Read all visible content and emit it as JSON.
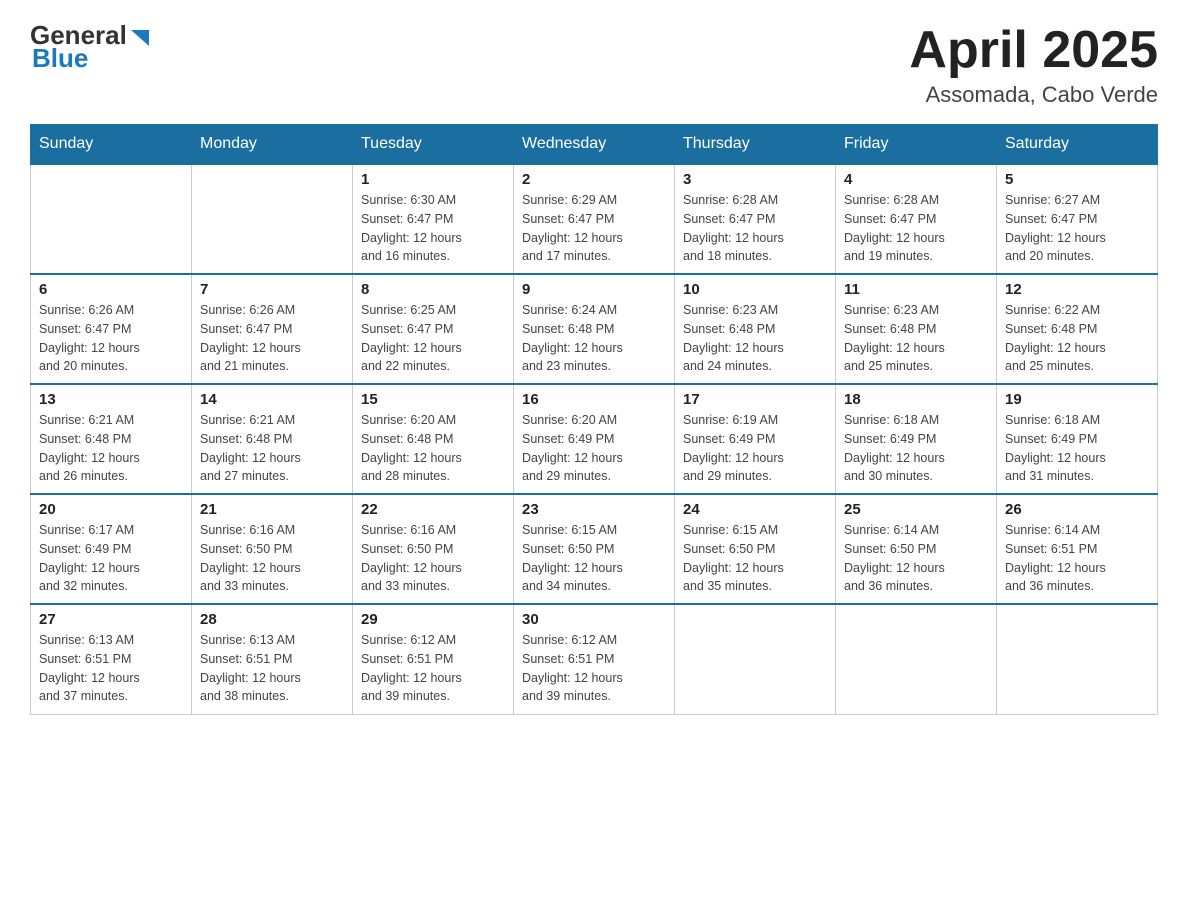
{
  "header": {
    "logo_general": "General",
    "logo_blue": "Blue",
    "title": "April 2025",
    "subtitle": "Assomada, Cabo Verde"
  },
  "days_of_week": [
    "Sunday",
    "Monday",
    "Tuesday",
    "Wednesday",
    "Thursday",
    "Friday",
    "Saturday"
  ],
  "weeks": [
    [
      {
        "day": "",
        "info": ""
      },
      {
        "day": "",
        "info": ""
      },
      {
        "day": "1",
        "info": "Sunrise: 6:30 AM\nSunset: 6:47 PM\nDaylight: 12 hours\nand 16 minutes."
      },
      {
        "day": "2",
        "info": "Sunrise: 6:29 AM\nSunset: 6:47 PM\nDaylight: 12 hours\nand 17 minutes."
      },
      {
        "day": "3",
        "info": "Sunrise: 6:28 AM\nSunset: 6:47 PM\nDaylight: 12 hours\nand 18 minutes."
      },
      {
        "day": "4",
        "info": "Sunrise: 6:28 AM\nSunset: 6:47 PM\nDaylight: 12 hours\nand 19 minutes."
      },
      {
        "day": "5",
        "info": "Sunrise: 6:27 AM\nSunset: 6:47 PM\nDaylight: 12 hours\nand 20 minutes."
      }
    ],
    [
      {
        "day": "6",
        "info": "Sunrise: 6:26 AM\nSunset: 6:47 PM\nDaylight: 12 hours\nand 20 minutes."
      },
      {
        "day": "7",
        "info": "Sunrise: 6:26 AM\nSunset: 6:47 PM\nDaylight: 12 hours\nand 21 minutes."
      },
      {
        "day": "8",
        "info": "Sunrise: 6:25 AM\nSunset: 6:47 PM\nDaylight: 12 hours\nand 22 minutes."
      },
      {
        "day": "9",
        "info": "Sunrise: 6:24 AM\nSunset: 6:48 PM\nDaylight: 12 hours\nand 23 minutes."
      },
      {
        "day": "10",
        "info": "Sunrise: 6:23 AM\nSunset: 6:48 PM\nDaylight: 12 hours\nand 24 minutes."
      },
      {
        "day": "11",
        "info": "Sunrise: 6:23 AM\nSunset: 6:48 PM\nDaylight: 12 hours\nand 25 minutes."
      },
      {
        "day": "12",
        "info": "Sunrise: 6:22 AM\nSunset: 6:48 PM\nDaylight: 12 hours\nand 25 minutes."
      }
    ],
    [
      {
        "day": "13",
        "info": "Sunrise: 6:21 AM\nSunset: 6:48 PM\nDaylight: 12 hours\nand 26 minutes."
      },
      {
        "day": "14",
        "info": "Sunrise: 6:21 AM\nSunset: 6:48 PM\nDaylight: 12 hours\nand 27 minutes."
      },
      {
        "day": "15",
        "info": "Sunrise: 6:20 AM\nSunset: 6:48 PM\nDaylight: 12 hours\nand 28 minutes."
      },
      {
        "day": "16",
        "info": "Sunrise: 6:20 AM\nSunset: 6:49 PM\nDaylight: 12 hours\nand 29 minutes."
      },
      {
        "day": "17",
        "info": "Sunrise: 6:19 AM\nSunset: 6:49 PM\nDaylight: 12 hours\nand 29 minutes."
      },
      {
        "day": "18",
        "info": "Sunrise: 6:18 AM\nSunset: 6:49 PM\nDaylight: 12 hours\nand 30 minutes."
      },
      {
        "day": "19",
        "info": "Sunrise: 6:18 AM\nSunset: 6:49 PM\nDaylight: 12 hours\nand 31 minutes."
      }
    ],
    [
      {
        "day": "20",
        "info": "Sunrise: 6:17 AM\nSunset: 6:49 PM\nDaylight: 12 hours\nand 32 minutes."
      },
      {
        "day": "21",
        "info": "Sunrise: 6:16 AM\nSunset: 6:50 PM\nDaylight: 12 hours\nand 33 minutes."
      },
      {
        "day": "22",
        "info": "Sunrise: 6:16 AM\nSunset: 6:50 PM\nDaylight: 12 hours\nand 33 minutes."
      },
      {
        "day": "23",
        "info": "Sunrise: 6:15 AM\nSunset: 6:50 PM\nDaylight: 12 hours\nand 34 minutes."
      },
      {
        "day": "24",
        "info": "Sunrise: 6:15 AM\nSunset: 6:50 PM\nDaylight: 12 hours\nand 35 minutes."
      },
      {
        "day": "25",
        "info": "Sunrise: 6:14 AM\nSunset: 6:50 PM\nDaylight: 12 hours\nand 36 minutes."
      },
      {
        "day": "26",
        "info": "Sunrise: 6:14 AM\nSunset: 6:51 PM\nDaylight: 12 hours\nand 36 minutes."
      }
    ],
    [
      {
        "day": "27",
        "info": "Sunrise: 6:13 AM\nSunset: 6:51 PM\nDaylight: 12 hours\nand 37 minutes."
      },
      {
        "day": "28",
        "info": "Sunrise: 6:13 AM\nSunset: 6:51 PM\nDaylight: 12 hours\nand 38 minutes."
      },
      {
        "day": "29",
        "info": "Sunrise: 6:12 AM\nSunset: 6:51 PM\nDaylight: 12 hours\nand 39 minutes."
      },
      {
        "day": "30",
        "info": "Sunrise: 6:12 AM\nSunset: 6:51 PM\nDaylight: 12 hours\nand 39 minutes."
      },
      {
        "day": "",
        "info": ""
      },
      {
        "day": "",
        "info": ""
      },
      {
        "day": "",
        "info": ""
      }
    ]
  ]
}
